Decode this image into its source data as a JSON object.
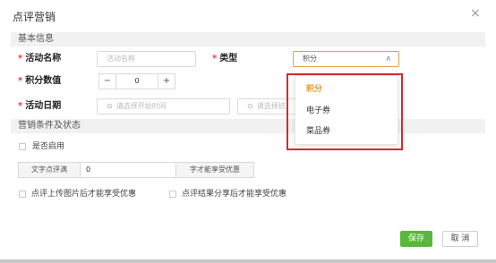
{
  "dialog": {
    "title": "点评营销"
  },
  "basic_section": {
    "title": "基本信息"
  },
  "fields": {
    "activity_name": {
      "label": "活动名称",
      "placeholder": "活动名称"
    },
    "type": {
      "label": "类型",
      "value": "积分"
    },
    "points": {
      "label": "积分数值",
      "decrement": "−",
      "value": "0",
      "increment": "+"
    },
    "activity_date": {
      "label": "活动日期",
      "start_placeholder": "请选择开始时间",
      "end_placeholder": "请选择结"
    }
  },
  "conditions_section": {
    "title": "营销条件及状态",
    "enable_label": "是否启用",
    "text_review_prefix": "文字点评满",
    "text_review_value": "0",
    "text_review_suffix": "字才能享受优惠",
    "upload_photo_label": "点评上传图片后才能享受优惠",
    "share_result_label": "点评结果分享后才能享受优惠"
  },
  "type_dropdown": {
    "options": [
      "积分",
      "电子券",
      "菜品券"
    ],
    "selected": "积分"
  },
  "footer": {
    "save": "保存",
    "cancel": "取 消"
  },
  "icons": {
    "close": "close-icon",
    "chevron": "chevron-up-icon",
    "clock": "clock-icon"
  },
  "colors": {
    "accent": "#e29b2a",
    "required": "#e23b3b",
    "save_button": "#59b73a",
    "highlight_box": "#d7282e"
  }
}
